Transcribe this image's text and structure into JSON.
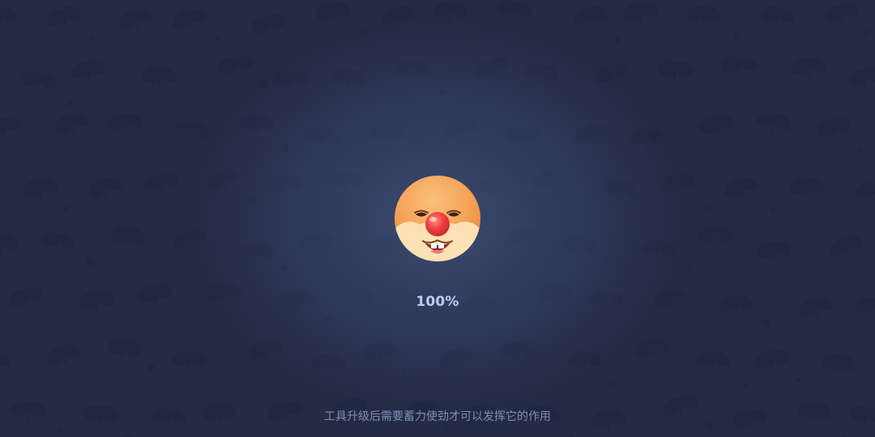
{
  "loading": {
    "progress_percent": 100,
    "progress_label": "100%",
    "tip_text": "工具升级后需要蓄力使劲才可以发挥它的作用"
  },
  "mascot": {
    "icon": "hamster-face-icon",
    "colors": {
      "fur": "#f5a65a",
      "cheeks": "#fbe3b6",
      "nose": "#ee3f3f"
    }
  },
  "background": {
    "colors": {
      "center": "#3c4a6e",
      "edge": "#252b45"
    },
    "pattern_icon": "sprout-leaf-icon"
  }
}
